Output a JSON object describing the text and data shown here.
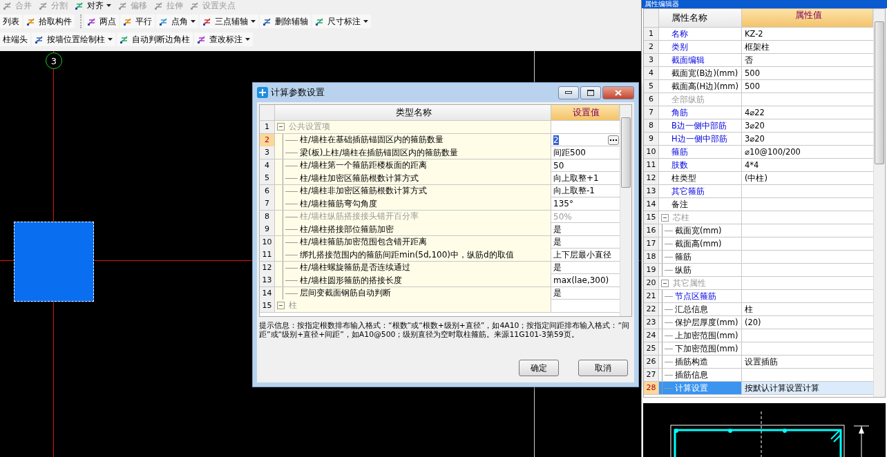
{
  "toolbar": {
    "rows": [
      {
        "toolbars": [
          {
            "items": [
              {
                "label": "合并",
                "kind": "tool",
                "disabled": true,
                "dropdown": false
              },
              {
                "label": "分割",
                "kind": "tool",
                "disabled": true,
                "dropdown": false
              },
              {
                "label": "对齐",
                "kind": "tool",
                "disabled": false,
                "dropdown": true
              },
              {
                "label": "偏移",
                "kind": "tool",
                "disabled": true,
                "dropdown": false
              },
              {
                "label": "拉伸",
                "kind": "tool",
                "disabled": true,
                "dropdown": false
              },
              {
                "label": "设置夹点",
                "kind": "tool",
                "disabled": true,
                "dropdown": false
              }
            ]
          }
        ]
      },
      {
        "toolbars": [
          {
            "items": [
              {
                "label": "列表",
                "kind": "plain",
                "disabled": false,
                "dropdown": false
              },
              {
                "label": "拾取构件",
                "kind": "tool",
                "disabled": false,
                "dropdown": false
              }
            ]
          },
          {
            "items": [
              {
                "label": "两点",
                "kind": "tool",
                "disabled": false,
                "dropdown": false
              },
              {
                "label": "平行",
                "kind": "tool",
                "disabled": false,
                "dropdown": false
              },
              {
                "label": "点角",
                "kind": "tool",
                "disabled": false,
                "dropdown": true
              },
              {
                "label": "三点辅轴",
                "kind": "tool",
                "disabled": false,
                "dropdown": true
              },
              {
                "label": "删除辅轴",
                "kind": "tool",
                "disabled": false,
                "dropdown": false
              },
              {
                "label": "尺寸标注",
                "kind": "tool",
                "disabled": false,
                "dropdown": true
              }
            ]
          }
        ]
      },
      {
        "toolbars": [
          {
            "items": [
              {
                "label": "柱端头",
                "kind": "plain",
                "disabled": false,
                "dropdown": false
              },
              {
                "label": "按墙位置绘制柱",
                "kind": "tool",
                "disabled": false,
                "dropdown": true
              },
              {
                "label": "自动判断边角柱",
                "kind": "tool",
                "disabled": false,
                "dropdown": false
              },
              {
                "label": "查改标注",
                "kind": "tool",
                "disabled": false,
                "dropdown": true
              }
            ]
          }
        ]
      }
    ]
  },
  "canvas": {
    "axis_label": "3"
  },
  "dialog": {
    "title": "计算参数设置",
    "columns": [
      "类型名称",
      "设置值"
    ],
    "rows": [
      {
        "num": "1",
        "name": "公共设置项",
        "kind": "group",
        "selected": false,
        "disabled": true,
        "children": [
          {
            "num": "2",
            "name": "柱/墙柱在基础插筋锚固区内的箍筋数量",
            "value": "2",
            "kind": "item",
            "selected": true,
            "disabled": false
          },
          {
            "num": "3",
            "name": "梁(板)上柱/墙柱在插筋锚固区内的箍筋数量",
            "value": "间距500",
            "kind": "item",
            "selected": false,
            "disabled": false
          },
          {
            "num": "4",
            "name": "柱/墙柱第一个箍筋距楼板面的距离",
            "value": "50",
            "kind": "item",
            "selected": false,
            "disabled": false
          },
          {
            "num": "5",
            "name": "柱/墙柱加密区箍筋根数计算方式",
            "value": "向上取整+1",
            "kind": "item",
            "selected": false,
            "disabled": false
          },
          {
            "num": "6",
            "name": "柱/墙柱非加密区箍筋根数计算方式",
            "value": "向上取整-1",
            "kind": "item",
            "selected": false,
            "disabled": false
          },
          {
            "num": "7",
            "name": "柱/墙柱箍筋弯勾角度",
            "value": "135°",
            "kind": "item",
            "selected": false,
            "disabled": false
          },
          {
            "num": "8",
            "name": "柱/墙柱纵筋搭接接头错开百分率",
            "value": "50%",
            "kind": "item",
            "selected": false,
            "disabled": true
          },
          {
            "num": "9",
            "name": "柱/墙柱搭接部位箍筋加密",
            "value": "是",
            "kind": "item",
            "selected": false,
            "disabled": false
          },
          {
            "num": "10",
            "name": "柱/墙柱箍筋加密范围包含错开距离",
            "value": "是",
            "kind": "item",
            "selected": false,
            "disabled": false
          },
          {
            "num": "11",
            "name": "绑扎搭接范围内的箍筋间距min(5d,100)中，纵筋d的取值",
            "value": "上下层最小直径",
            "kind": "item",
            "selected": false,
            "disabled": false
          },
          {
            "num": "12",
            "name": "柱/墙柱螺旋箍筋是否连续通过",
            "value": "是",
            "kind": "item",
            "selected": false,
            "disabled": false
          },
          {
            "num": "13",
            "name": "柱/墙柱圆形箍筋的搭接长度",
            "value": "max(lae,300)",
            "kind": "item",
            "selected": false,
            "disabled": false
          },
          {
            "num": "14",
            "name": "层间变截面钢筋自动判断",
            "value": "是",
            "kind": "item",
            "selected": false,
            "disabled": false
          }
        ]
      },
      {
        "num": "15",
        "name": "柱",
        "kind": "group",
        "selected": false,
        "disabled": true
      }
    ],
    "hint": "提示信息：按指定根数排布输入格式：“根数”或“根数+级别+直径”，如4A10；按指定间距排布输入格式：“间距”或“级别+直径+间距”，如A10@500；级别直径为空时取柱箍筋。来源11G101-3第59页。",
    "buttons": [
      "确定",
      "取消"
    ]
  },
  "properties": {
    "title": "属性编辑器",
    "columns": [
      "属性名称",
      "属性值"
    ],
    "rows": [
      {
        "num": "1",
        "name": "名称",
        "value": "KZ-2",
        "kind": "item",
        "public": true,
        "disabled": false,
        "selected": false
      },
      {
        "num": "2",
        "name": "类别",
        "value": "框架柱",
        "kind": "item",
        "public": true,
        "disabled": false,
        "selected": false
      },
      {
        "num": "3",
        "name": "截面编辑",
        "value": "否",
        "kind": "item",
        "public": true,
        "disabled": false,
        "selected": false
      },
      {
        "num": "4",
        "name": "截面宽(B边)(mm)",
        "value": "500",
        "kind": "item",
        "public": false,
        "disabled": false,
        "selected": false
      },
      {
        "num": "5",
        "name": "截面高(H边)(mm)",
        "value": "500",
        "kind": "item",
        "public": false,
        "disabled": false,
        "selected": false
      },
      {
        "num": "6",
        "name": "全部纵筋",
        "kind": "item",
        "public": false,
        "disabled": true,
        "selected": false
      },
      {
        "num": "7",
        "name": "角筋",
        "value": "4⌀22",
        "kind": "item",
        "public": true,
        "disabled": false,
        "selected": false
      },
      {
        "num": "8",
        "name": "B边一侧中部筋",
        "value": "3⌀20",
        "kind": "item",
        "public": true,
        "disabled": false,
        "selected": false
      },
      {
        "num": "9",
        "name": "H边一侧中部筋",
        "value": "3⌀20",
        "kind": "item",
        "public": true,
        "disabled": false,
        "selected": false
      },
      {
        "num": "10",
        "name": "箍筋",
        "value": "⌀10@100/200",
        "kind": "item",
        "public": true,
        "disabled": false,
        "selected": false
      },
      {
        "num": "11",
        "name": "肢数",
        "value": "4*4",
        "kind": "item",
        "public": true,
        "disabled": false,
        "selected": false
      },
      {
        "num": "12",
        "name": "柱类型",
        "value": "(中柱)",
        "kind": "item",
        "public": false,
        "disabled": false,
        "selected": false
      },
      {
        "num": "13",
        "name": "其它箍筋",
        "kind": "item",
        "public": true,
        "disabled": false,
        "selected": false
      },
      {
        "num": "14",
        "name": "备注",
        "kind": "item",
        "public": false,
        "disabled": false,
        "selected": false
      },
      {
        "num": "15",
        "name": "芯柱",
        "kind": "group",
        "public": false,
        "disabled": true,
        "selected": false,
        "children": [
          {
            "num": "16",
            "name": "截面宽(mm)",
            "kind": "item",
            "public": false,
            "disabled": false,
            "selected": false
          },
          {
            "num": "17",
            "name": "截面高(mm)",
            "kind": "item",
            "public": false,
            "disabled": false,
            "selected": false
          },
          {
            "num": "18",
            "name": "箍筋",
            "kind": "item",
            "public": false,
            "disabled": false,
            "selected": false
          },
          {
            "num": "19",
            "name": "纵筋",
            "kind": "item",
            "public": false,
            "disabled": false,
            "selected": false
          }
        ]
      },
      {
        "num": "20",
        "name": "其它属性",
        "kind": "group",
        "public": false,
        "disabled": true,
        "selected": false,
        "children": [
          {
            "num": "21",
            "name": "节点区箍筋",
            "kind": "item",
            "public": true,
            "disabled": false,
            "selected": false
          },
          {
            "num": "22",
            "name": "汇总信息",
            "value": "柱",
            "kind": "item",
            "public": false,
            "disabled": false,
            "selected": false
          },
          {
            "num": "23",
            "name": "保护层厚度(mm)",
            "value": "(20)",
            "kind": "item",
            "public": false,
            "disabled": false,
            "selected": false
          },
          {
            "num": "24",
            "name": "上加密范围(mm)",
            "kind": "item",
            "public": false,
            "disabled": false,
            "selected": false
          },
          {
            "num": "25",
            "name": "下加密范围(mm)",
            "kind": "item",
            "public": false,
            "disabled": false,
            "selected": false
          },
          {
            "num": "26",
            "name": "插筋构造",
            "value": "设置插筋",
            "kind": "item",
            "public": false,
            "disabled": false,
            "selected": false
          },
          {
            "num": "27",
            "name": "插筋信息",
            "kind": "item",
            "public": false,
            "disabled": false,
            "selected": false
          },
          {
            "num": "28",
            "name": "计算设置",
            "value": "按默认计算设置计算",
            "kind": "item",
            "public": false,
            "disabled": false,
            "selected": true
          }
        ]
      }
    ]
  }
}
